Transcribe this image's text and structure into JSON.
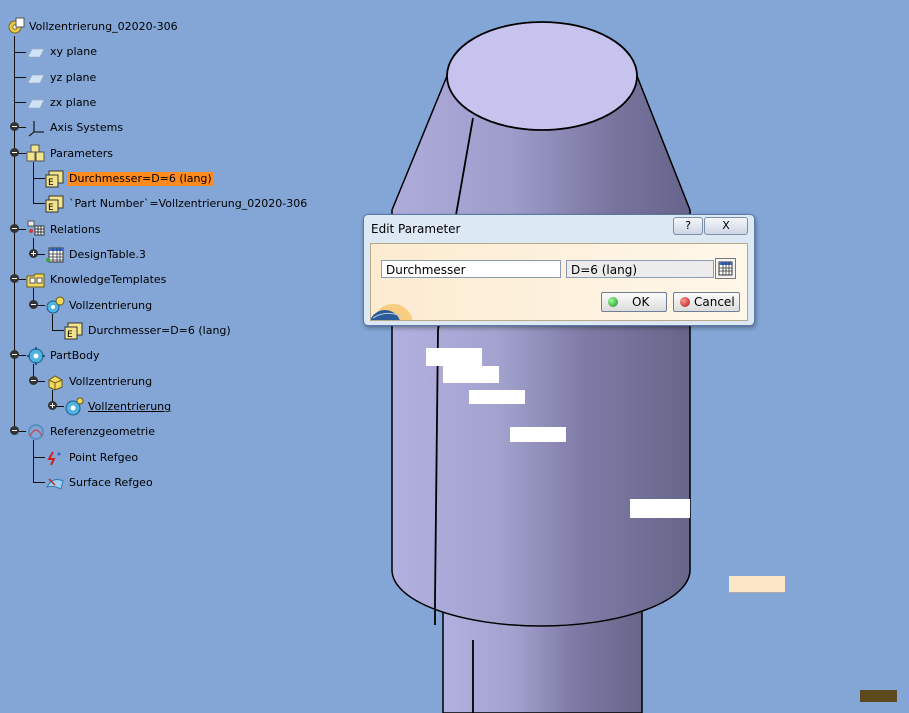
{
  "colors": {
    "background": "#83a6d6",
    "selection": "#ff8a1e",
    "part": "#8a88b6",
    "dialog_client": "#fcebd0"
  },
  "tree": {
    "root": {
      "label": "Vollzentrierung_02020-306",
      "icon": "part-gear-icon"
    },
    "nodes": [
      {
        "label": "xy plane",
        "icon": "plane-icon"
      },
      {
        "label": "yz plane",
        "icon": "plane-icon"
      },
      {
        "label": "zx plane",
        "icon": "plane-icon"
      },
      {
        "label": "Axis Systems",
        "icon": "axis-system-icon"
      },
      {
        "label": "Parameters",
        "icon": "parameters-icon"
      },
      {
        "label": "Durchmesser=D=6 (lang)",
        "icon": "parameter-icon",
        "selected": true
      },
      {
        "label": "`Part Number`=Vollzentrierung_02020-306",
        "icon": "parameter-icon"
      },
      {
        "label": "Relations",
        "icon": "relations-icon"
      },
      {
        "label": "DesignTable.3",
        "icon": "design-table-icon"
      },
      {
        "label": "KnowledgeTemplates",
        "icon": "knowledge-templates-icon"
      },
      {
        "label": "Vollzentrierung",
        "icon": "template-gear-icon"
      },
      {
        "label": "Durchmesser=D=6 (lang)",
        "icon": "parameter-icon"
      },
      {
        "label": "PartBody",
        "icon": "partbody-icon"
      },
      {
        "label": "Vollzentrierung",
        "icon": "powercopy-icon"
      },
      {
        "label": "Vollzentrierung",
        "icon": "instance-gear-icon",
        "underlined": true
      },
      {
        "label": "Referenzgeometrie",
        "icon": "geometrical-set-icon"
      },
      {
        "label": "Point Refgeo",
        "icon": "point-icon"
      },
      {
        "label": "Surface Refgeo",
        "icon": "surface-icon"
      }
    ]
  },
  "dialog": {
    "title": "Edit Parameter",
    "help_label": "?",
    "close_label": "X",
    "name_value": "Durchmesser",
    "value_value": "D=6 (lang)",
    "ok_label": "OK",
    "cancel_label": "Cancel"
  }
}
